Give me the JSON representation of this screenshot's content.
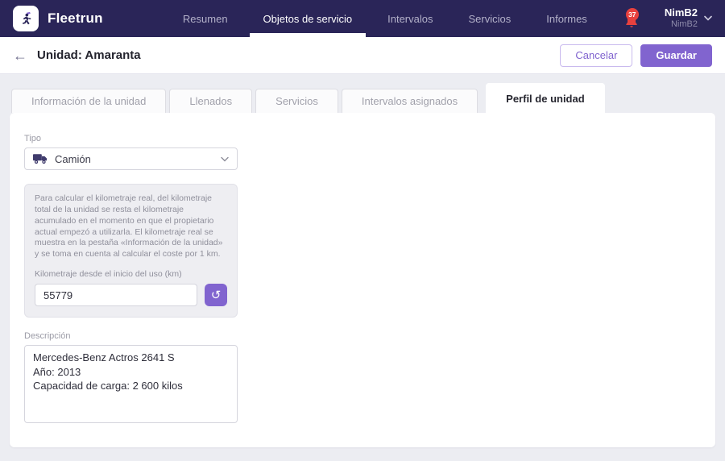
{
  "header": {
    "brand": "Fleetrun",
    "nav": [
      {
        "label": "Resumen",
        "active": false
      },
      {
        "label": "Objetos de servicio",
        "active": true
      },
      {
        "label": "Intervalos",
        "active": false
      },
      {
        "label": "Servicios",
        "active": false
      },
      {
        "label": "Informes",
        "active": false
      }
    ],
    "notifications_count": "37",
    "user_name": "NimB2",
    "user_account": "NimB2"
  },
  "toolbar": {
    "back_icon": "←",
    "title": "Unidad: Amaranta",
    "cancel_label": "Cancelar",
    "save_label": "Guardar"
  },
  "tabs": [
    {
      "label": "Información de la unidad",
      "active": false
    },
    {
      "label": "Llenados",
      "active": false
    },
    {
      "label": "Servicios",
      "active": false
    },
    {
      "label": "Intervalos asignados",
      "active": false
    },
    {
      "label": "Perfil de unidad",
      "active": true
    }
  ],
  "form": {
    "type_label": "Tipo",
    "type_value": "Camión",
    "mileage_help": "Para calcular el kilometraje real, del kilometraje total de la unidad se resta el kilometraje acumulado en el momento en que el propietario actual empezó a utilizarla. El kilometraje real se muestra en la pestaña «Información de la unidad» y se toma en cuenta al calcular el coste por 1 km.",
    "mileage_label": "Kilometraje desde el inicio del uso (km)",
    "mileage_value": "55779",
    "reset_icon": "↺",
    "description_label": "Descripción",
    "description_value": "Mercedes-Benz Actros 2641 S\nAño: 2013\nCapacidad de carga: 2 600 kilos"
  },
  "colors": {
    "header_bg": "#2a2558",
    "accent_purple": "#8164cf",
    "notification_red": "#e8413e",
    "page_bg": "#ecedf2"
  }
}
